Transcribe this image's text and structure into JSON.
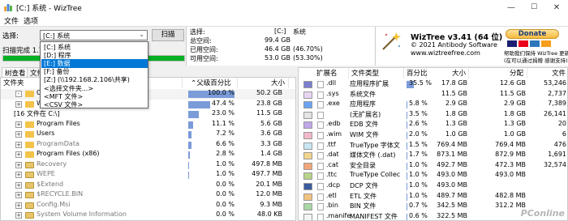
{
  "window": {
    "title": "[C:] 系统 - WizTree",
    "min": "—",
    "max": "☐",
    "close": "✕"
  },
  "menu": [
    "文件",
    "选项"
  ],
  "toolbar": {
    "select_label": "选择:",
    "drive_value": "[C:] 系统",
    "scan_button": "扫描",
    "scan_status": "扫描完成 1.70",
    "progress_pct": 100
  },
  "dropdown": {
    "options": [
      "[C:] 系统",
      "[D:] 程序",
      "[E:] 数据",
      "[F:] 备份",
      "[Z:] (\\\\192.168.2.106\\共享)",
      "<选择文件夹...>",
      "<MFT 文件>",
      "<CSV 文件>"
    ],
    "selected_index": 2
  },
  "stats": {
    "select_label": "选择:",
    "drive": "[C:]",
    "drive_name": "系统",
    "rows": [
      {
        "k": "总空间:",
        "v": "99.4 GB",
        "p": ""
      },
      {
        "k": "已用空间:",
        "v": "46.4 GB",
        "p": "(46.70%)"
      },
      {
        "k": "可用空间:",
        "v": "53.0 GB",
        "p": "(53.30%)"
      }
    ]
  },
  "brand": {
    "name": "WizTree v3.41 (64 位)",
    "copyright": "© 2021 Antibody Software",
    "url": "www.wiztreefree.com",
    "donate": "Donate",
    "note": "(在可以通过捐赠 感谢支持)",
    "support": "帮助我们保持 WizTree 更新!"
  },
  "tree": {
    "tabs": [
      "树查看",
      "文件"
    ],
    "headers": {
      "folder": "文件夹",
      "pct": "父级百分比",
      "size": "大小"
    },
    "rows": [
      {
        "name": "C:\\",
        "pct": "100.0 %",
        "pctv": 100,
        "size": "50.2 GB",
        "kind": "drive",
        "exp": "-"
      },
      {
        "name": "Windows",
        "pct": "47.4 %",
        "pctv": 47.4,
        "size": "23.8 GB",
        "kind": "folder",
        "exp": "+"
      },
      {
        "name": "[16 文件在 C:\\]",
        "pct": "23.0 %",
        "pctv": 23,
        "size": "11.5 GB",
        "kind": "none",
        "exp": ""
      },
      {
        "name": "Program Files",
        "pct": "11.1 %",
        "pctv": 11.1,
        "size": "5.6 GB",
        "kind": "folder",
        "exp": "+"
      },
      {
        "name": "Users",
        "pct": "7.2 %",
        "pctv": 7.2,
        "size": "3.6 GB",
        "kind": "folder",
        "exp": "+"
      },
      {
        "name": "ProgramData",
        "pct": "6.6 %",
        "pctv": 6.6,
        "size": "3.3 GB",
        "kind": "folder-dim",
        "exp": "+"
      },
      {
        "name": "Program Files (x86)",
        "pct": "2.8 %",
        "pctv": 2.8,
        "size": "1.4 GB",
        "kind": "folder",
        "exp": "+"
      },
      {
        "name": "Recovery",
        "pct": "1.0 %",
        "pctv": 1,
        "size": "497.8 MB",
        "kind": "sys",
        "exp": "+"
      },
      {
        "name": "WEPE",
        "pct": "1.0 %",
        "pctv": 1,
        "size": "497.7 MB",
        "kind": "sys",
        "exp": "+"
      },
      {
        "name": "$Extend",
        "pct": "0.0 %",
        "pctv": 0,
        "size": "20.1 MB",
        "kind": "sys",
        "exp": "+"
      },
      {
        "name": "$RECYCLE.BIN",
        "pct": "0.0 %",
        "pctv": 0,
        "size": "12.0 MB",
        "kind": "sys",
        "exp": "+"
      },
      {
        "name": "Config.Msi",
        "pct": "0.0 %",
        "pctv": 0,
        "size": "9.3 MB",
        "kind": "sys",
        "exp": "+"
      },
      {
        "name": "System Volume Information",
        "pct": "0.0 %",
        "pctv": 0,
        "size": "48.0 KB",
        "kind": "sys",
        "exp": "+"
      },
      {
        "name": "Link",
        "pct": "0.0 %",
        "pctv": 0,
        "size": "44.0 KB",
        "kind": "folder",
        "exp": "+"
      }
    ]
  },
  "ext": {
    "headers": {
      "ext": "扩展名",
      "type": "文件类型",
      "pct": "百分比",
      "size": "大小",
      "alloc": "分配",
      "count": "文件"
    },
    "rows": [
      {
        "ext": ".dll",
        "type": "应用程序扩展",
        "pct": "35.5 %",
        "pctv": 35.5,
        "size": "17.8 GB",
        "alloc": "12.6 GB",
        "count": "53,246",
        "color": "#7b7fd0"
      },
      {
        "ext": ".sys",
        "type": "系统文件",
        "pct": "",
        "pctv": 0,
        "size": "11.5 GB",
        "alloc": "11.5 GB",
        "count": "2,737",
        "color": "#e9d4f3"
      },
      {
        "ext": ".exe",
        "type": "应用程序",
        "pct": "5.8 %",
        "pctv": 5.8,
        "size": "2.9 GB",
        "alloc": "2.9 GB",
        "count": "7,389",
        "color": "#6aa3f2"
      },
      {
        "ext": "",
        "type": "(无扩展名)",
        "pct": "3.5 %",
        "pctv": 3.5,
        "size": "1.8 GB",
        "alloc": "1.8 GB",
        "count": "26,141",
        "color": "#e4e4e4"
      },
      {
        "ext": ".edb",
        "type": "EDB 文件",
        "pct": "2.6 %",
        "pctv": 2.6,
        "size": "1.3 GB",
        "alloc": "1.3 GB",
        "count": "20",
        "color": "#bfa7e8"
      },
      {
        "ext": ".wim",
        "type": "WIM 文件",
        "pct": "2.0 %",
        "pctv": 2,
        "size": "1.0 GB",
        "alloc": "1.0 GB",
        "count": "6",
        "color": "#f0b8c8"
      },
      {
        "ext": ".ttf",
        "type": "TrueType 字体文件",
        "pct": "1.5 %",
        "pctv": 1.5,
        "size": "769.4 MB",
        "alloc": "769.4 MB",
        "count": "476",
        "color": "#c8e6f3"
      },
      {
        "ext": ".dat",
        "type": "媒体文件 (.dat)",
        "pct": "1.7 %",
        "pctv": 1.7,
        "size": "873.1 MB",
        "alloc": "872.9 MB",
        "count": "1,691",
        "color": "#f2d58e"
      },
      {
        "ext": ".cat",
        "type": "安全目录",
        "pct": "1.0 %",
        "pctv": 1,
        "size": "492.7 MB",
        "alloc": "472.3 MB",
        "count": "32,574",
        "color": "#f2a57a"
      },
      {
        "ext": ".ttc",
        "type": "TrueType Collection",
        "pct": "1.0 %",
        "pctv": 1,
        "size": "493.0 MB",
        "alloc": "493.0 MB",
        "count": "",
        "color": "#b7d58a"
      },
      {
        "ext": ".dcp",
        "type": "DCP 文件",
        "pct": "1.0 %",
        "pctv": 1,
        "size": "493.0 MB",
        "alloc": "",
        "count": "",
        "color": "#3a5b9d"
      },
      {
        "ext": ".etl",
        "type": "ETL 文件",
        "pct": "1.0 %",
        "pctv": 1,
        "size": "489.7 MB",
        "alloc": "482.8 MB",
        "count": "",
        "color": "#f2c27f"
      },
      {
        "ext": ".bin",
        "type": "BIN 文件",
        "pct": "0.7 %",
        "pctv": 0.7,
        "size": "342.5 MB",
        "alloc": "312.2 MB",
        "count": "",
        "color": "#a9d6a5"
      },
      {
        "ext": ".manife",
        "type": "MANIFEST 文件",
        "pct": "0.6 %",
        "pctv": 0.6,
        "size": "322.5 MB",
        "alloc": "",
        "count": "",
        "color": "#f4f4f4"
      }
    ]
  },
  "watermark": "PConline"
}
